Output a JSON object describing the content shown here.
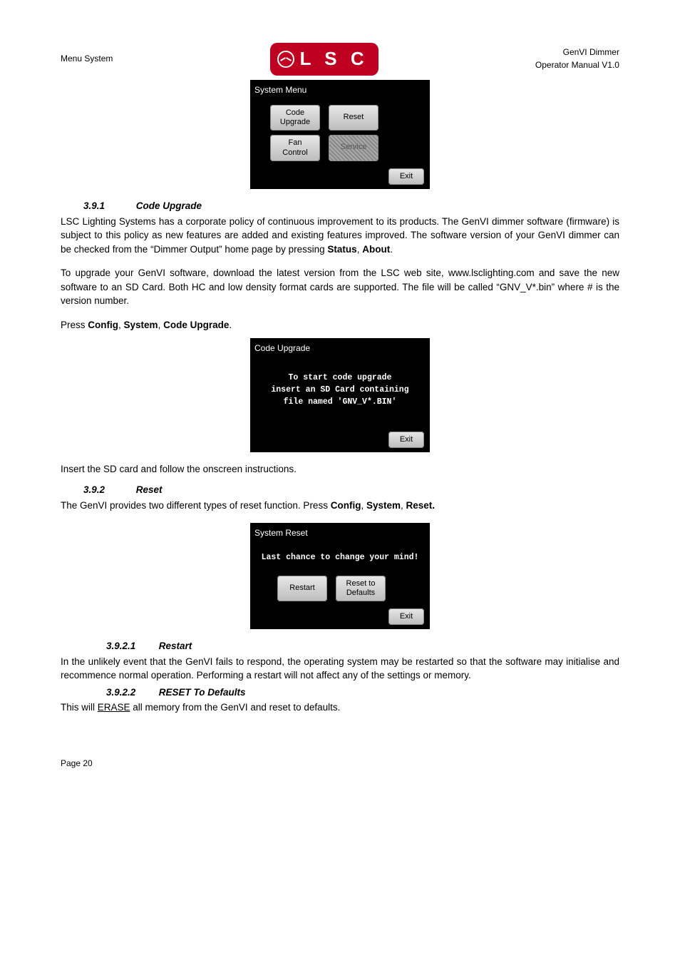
{
  "header": {
    "left": "Menu System",
    "logo_text": "L S C",
    "right_line1": "GenVI Dimmer",
    "right_line2": "Operator Manual V1.0"
  },
  "screen1": {
    "title": "System Menu",
    "row1_btn1_line1": "Code",
    "row1_btn1_line2": "Upgrade",
    "row1_btn2": "Reset",
    "row2_btn1_line1": "Fan",
    "row2_btn1_line2": "Control",
    "row2_btn2": "Service",
    "exit": "Exit"
  },
  "sec391": {
    "num": "3.9.1",
    "title": "Code Upgrade",
    "para1_a": "LSC Lighting Systems has a corporate policy of continuous improvement to its products. The GenVI dimmer software (firmware) is subject to this policy as new features are added and existing features improved. The software version of your GenVI dimmer can be checked from the “Dimmer Output” home page by pressing ",
    "para1_bold1": "Status",
    "para1_sep": ", ",
    "para1_bold2": "About",
    "para1_end": ".",
    "para2": "To upgrade your GenVI software, download the latest version from the LSC web site, www.lsclighting.com and save the new software to an SD Card. Both HC and low density format cards are supported. The file will be called “GNV_V*.bin” where # is the version number.",
    "press_a": "Press ",
    "press_b1": "Config",
    "press_s1": ", ",
    "press_b2": "System",
    "press_s2": ", ",
    "press_b3": "Code Upgrade",
    "press_end": "."
  },
  "screen2": {
    "title": "Code Upgrade",
    "line1": "To start code upgrade",
    "line2": "insert an SD Card containing",
    "line3": "file named 'GNV_V*.BIN'",
    "exit": "Exit"
  },
  "after_screen2": "Insert the SD card and follow the onscreen instructions.",
  "sec392": {
    "num": "3.9.2",
    "title": "Reset",
    "para_a": "The GenVI provides two different types of reset function. Press ",
    "para_b1": "Config",
    "para_s1": ", ",
    "para_b2": "System",
    "para_s2": ", ",
    "para_b3": "Reset.",
    "para_end": ""
  },
  "screen3": {
    "title": "System Reset",
    "msg": "Last chance to change your mind!",
    "btn1": "Restart",
    "btn2_line1": "Reset to",
    "btn2_line2": "Defaults",
    "exit": "Exit"
  },
  "sec3921": {
    "num": "3.9.2.1",
    "title": "Restart",
    "para": "In the unlikely event that the GenVI fails to respond, the operating system may be restarted so that the software may initialise and recommence normal operation. Performing a restart will not affect any of the settings or memory."
  },
  "sec3922": {
    "num": "3.9.2.2",
    "title": "RESET To Defaults",
    "para_a": "This will ",
    "para_u": "ERASE",
    "para_b": " all memory from the GenVI and reset to defaults."
  },
  "footer": "Page 20"
}
